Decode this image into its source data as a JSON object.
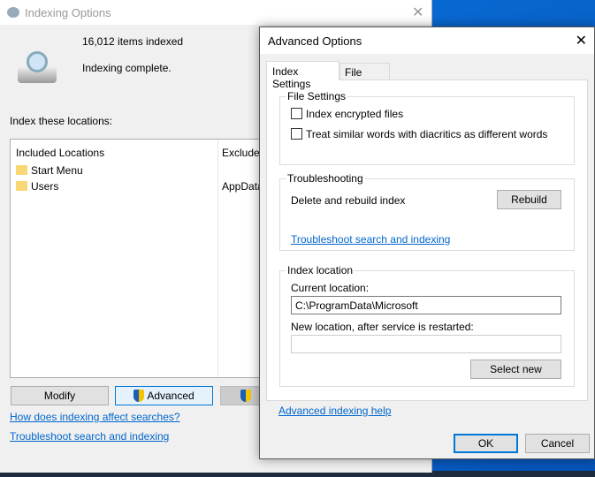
{
  "main": {
    "title": "Indexing Options",
    "items_indexed": "16,012 items indexed",
    "status": "Indexing complete.",
    "index_label": "Index these locations:",
    "columns": [
      "Included Locations",
      "Exclude"
    ],
    "rows": [
      {
        "location": "Start Menu",
        "exclude": ""
      },
      {
        "location": "Users",
        "exclude": "AppData"
      }
    ],
    "modify": "Modify",
    "advanced": "Advanced",
    "link1": "How does indexing affect searches?",
    "link2": "Troubleshoot search and indexing"
  },
  "dialog": {
    "title": "Advanced Options",
    "tabs": [
      "Index Settings",
      "File Types"
    ],
    "file_settings": "File Settings",
    "cb1": "Index encrypted files",
    "cb1_checked": false,
    "cb2": "Treat similar words with diacritics as different words",
    "cb2_checked": false,
    "troubleshooting": "Troubleshooting",
    "rebuild_label": "Delete and rebuild index",
    "rebuild": "Rebuild",
    "troubleshoot_link": "Troubleshoot search and indexing",
    "index_location": "Index location",
    "current_label": "Current location:",
    "current_value": "C:\\ProgramData\\Microsoft",
    "new_label": "New location, after service is restarted:",
    "new_value": "",
    "select_new": "Select new",
    "help_link": "Advanced indexing help",
    "ok": "OK",
    "cancel": "Cancel"
  }
}
